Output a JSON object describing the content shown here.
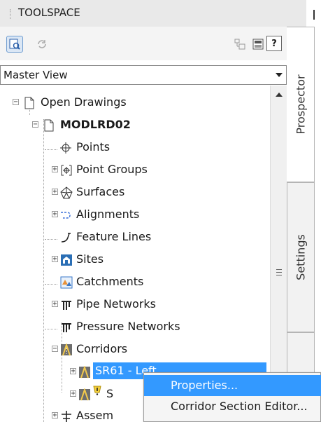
{
  "palette": {
    "title": "TOOLSPACE"
  },
  "toolbar": {
    "help_label": "?"
  },
  "view_select": {
    "value": "Master View"
  },
  "tree": [
    {
      "label": "Open Drawings",
      "icon": "drawings-icon",
      "expander": "−"
    },
    {
      "label": "MODLRD02",
      "icon": "drawing-icon",
      "expander": "−"
    },
    {
      "label": "Points",
      "icon": "points-icon",
      "expander": ""
    },
    {
      "label": "Point Groups",
      "icon": "point-groups-icon",
      "expander": "+"
    },
    {
      "label": "Surfaces",
      "icon": "surfaces-icon",
      "expander": "+"
    },
    {
      "label": "Alignments",
      "icon": "alignments-icon",
      "expander": "+"
    },
    {
      "label": "Feature Lines",
      "icon": "feature-lines-icon",
      "expander": ""
    },
    {
      "label": "Sites",
      "icon": "sites-icon",
      "expander": "+"
    },
    {
      "label": "Catchments",
      "icon": "catchments-icon",
      "expander": ""
    },
    {
      "label": "Pipe Networks",
      "icon": "pipe-networks-icon",
      "expander": "+"
    },
    {
      "label": "Pressure Networks",
      "icon": "pressure-networks-icon",
      "expander": ""
    },
    {
      "label": "Corridors",
      "icon": "corridors-icon",
      "expander": "−"
    },
    {
      "label": "SR61 - Left",
      "icon": "corridor-icon",
      "expander": "+"
    },
    {
      "label": "S",
      "icon": "corridor-icon",
      "expander": "+"
    },
    {
      "label": "Assem",
      "icon": "assemblies-icon",
      "expander": "+"
    }
  ],
  "tabs": {
    "prospector": "Prospector",
    "settings": "Settings"
  },
  "context_menu": {
    "items": [
      "Properties...",
      "Corridor Section Editor..."
    ]
  }
}
